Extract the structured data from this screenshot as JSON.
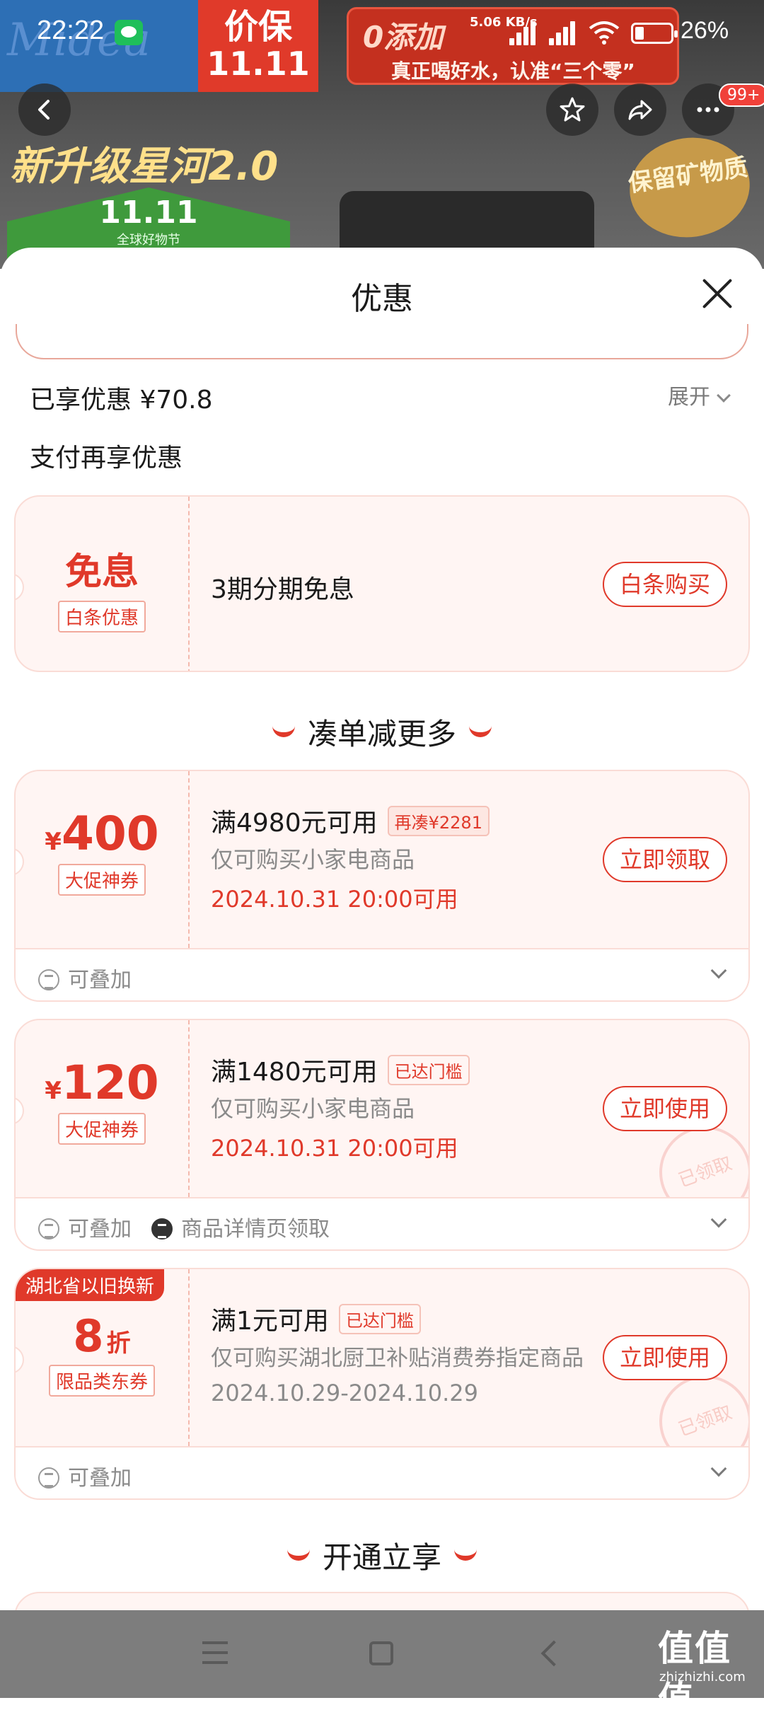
{
  "status_bar": {
    "time": "22:22",
    "network_speed": "5.06 KB/s",
    "battery_pct": "26%",
    "battery_level": 0.26
  },
  "banner": {
    "logo_text": "Midea",
    "price_line1": "价保",
    "price_line2": "11.11",
    "promo_line1": "0添加",
    "promo_line2": "真正喝好水，认准“三个零”",
    "slogan": "新升级星河2.0",
    "festival_title": "11.11",
    "festival_sub": "全球好物节",
    "badge": "保留矿物质"
  },
  "top_nav": {
    "more_badge": "99+"
  },
  "sheet": {
    "title": "优惠",
    "saved_text": "已享优惠 ¥70.8",
    "expand_label": "展开",
    "pay_more_text": "支付再享优惠"
  },
  "baitiao_card": {
    "big_text": "免息",
    "tag": "白条优惠",
    "description": "3期分期免息",
    "button": "白条购买"
  },
  "section1_title": "凑单减更多",
  "coupons": [
    {
      "symbol": "¥",
      "amount": "400",
      "tag": "大促神券",
      "condition": "满4980元可用",
      "badge": "再凑¥2281",
      "scope": "仅可购买小家电商品",
      "time": "2024.10.31 20:00可用",
      "button": "立即领取",
      "footer1": "可叠加",
      "footer2": ""
    },
    {
      "symbol": "¥",
      "amount": "120",
      "tag": "大促神券",
      "condition": "满1480元可用",
      "badge": "已达门槛",
      "scope": "仅可购买小家电商品",
      "time": "2024.10.31 20:00可用",
      "button": "立即使用",
      "footer1": "可叠加",
      "footer2": "商品详情页领取",
      "stamp": "已领取"
    },
    {
      "corner_label": "湖北省以旧换新",
      "amount": "8",
      "unit": "折",
      "tag": "限品类东券",
      "condition": "满1元可用",
      "badge": "已达门槛",
      "scope": "仅可购买湖北厨卫补贴消费券指定商品",
      "time": "2024.10.29-2024.10.29",
      "button": "立即使用",
      "footer1": "可叠加",
      "stamp": "已领取"
    }
  ],
  "section2_title": "开通立享",
  "watermark": {
    "text": "值值值",
    "sub": "zhizhizhi.com"
  },
  "colors": {
    "accent": "#e0392a",
    "card_bg": "#fff5f3",
    "card_border": "#fadcd6"
  }
}
